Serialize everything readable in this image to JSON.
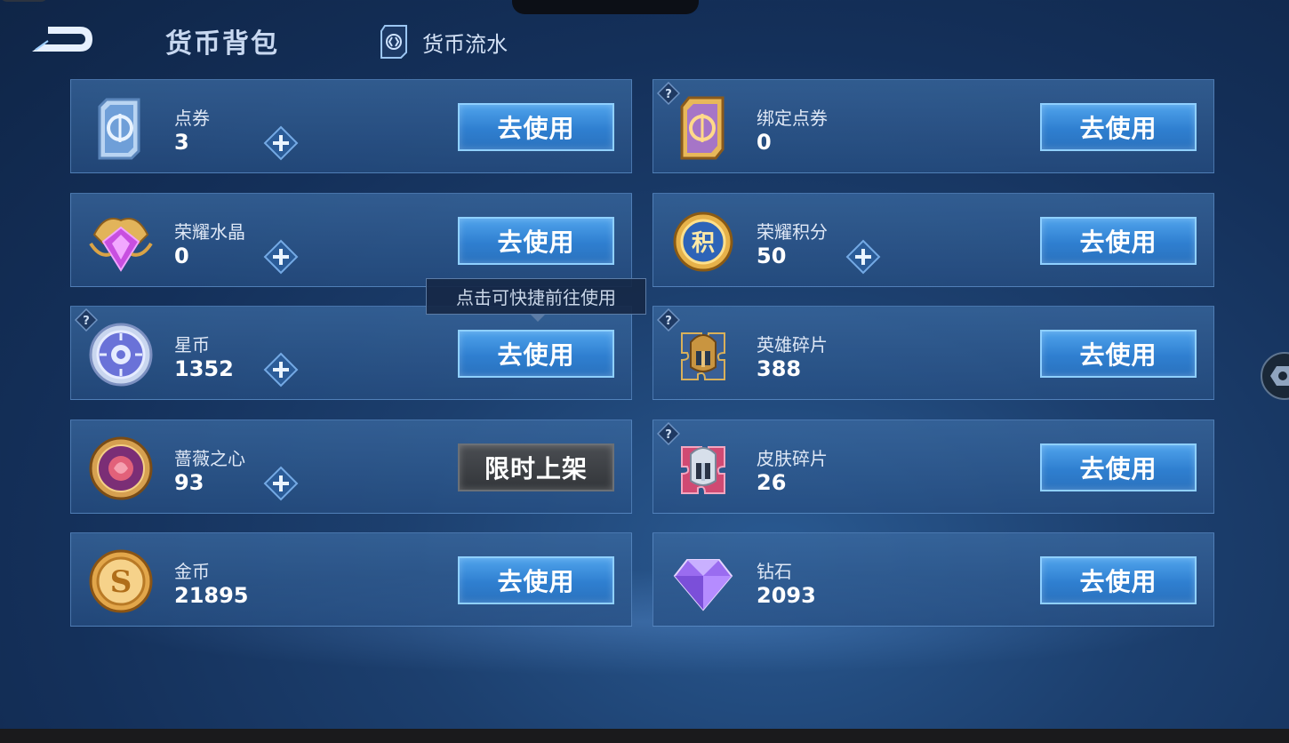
{
  "header": {
    "title": "货币背包",
    "flow_tab": "货币流水"
  },
  "colors": {
    "use_button": "#3a8ee0",
    "card_bg": "#2f5f9a",
    "limited_button": "#3d4046"
  },
  "tooltip": "点击可快捷前往使用",
  "currencies": [
    {
      "name": "点券",
      "amount": "3",
      "button": "去使用",
      "icon": "ticket-icon",
      "has_plus": true,
      "has_help": false
    },
    {
      "name": "绑定点券",
      "amount": "0",
      "button": "去使用",
      "icon": "bound-ticket-icon",
      "has_plus": false,
      "has_help": true
    },
    {
      "name": "荣耀水晶",
      "amount": "0",
      "button": "去使用",
      "icon": "glory-crystal-icon",
      "has_plus": true,
      "has_help": false
    },
    {
      "name": "荣耀积分",
      "amount": "50",
      "button": "去使用",
      "icon": "glory-points-icon",
      "has_plus": true,
      "has_help": false
    },
    {
      "name": "星币",
      "amount": "1352",
      "button": "去使用",
      "icon": "star-coin-icon",
      "has_plus": true,
      "has_help": true
    },
    {
      "name": "英雄碎片",
      "amount": "388",
      "button": "去使用",
      "icon": "hero-fragment-icon",
      "has_plus": false,
      "has_help": true
    },
    {
      "name": "蔷薇之心",
      "amount": "93",
      "button": "限时上架",
      "icon": "rose-heart-icon",
      "has_plus": true,
      "has_help": false
    },
    {
      "name": "皮肤碎片",
      "amount": "26",
      "button": "去使用",
      "icon": "skin-fragment-icon",
      "has_plus": false,
      "has_help": true
    },
    {
      "name": "金币",
      "amount": "21895",
      "button": "去使用",
      "icon": "gold-coin-icon",
      "has_plus": false,
      "has_help": false
    },
    {
      "name": "钻石",
      "amount": "2093",
      "button": "去使用",
      "icon": "diamond-icon",
      "has_plus": false,
      "has_help": false
    }
  ]
}
